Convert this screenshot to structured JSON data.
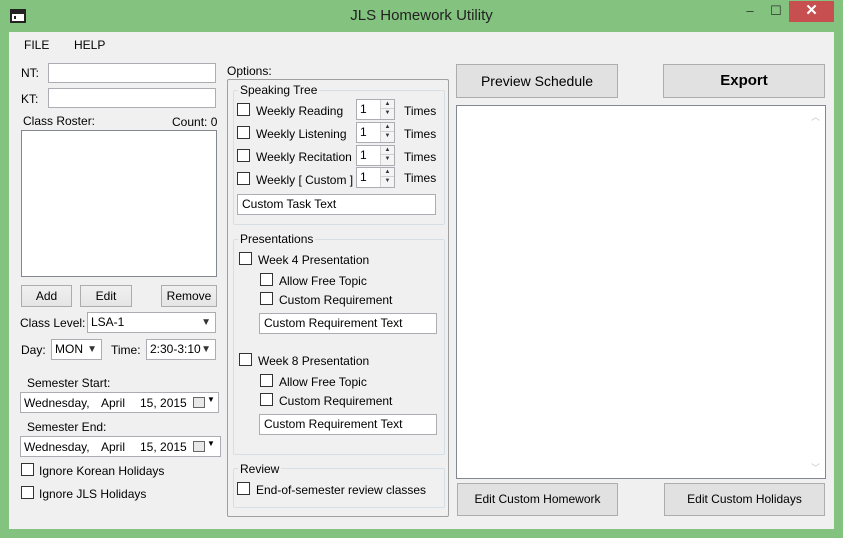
{
  "window": {
    "title": "JLS Homework Utility",
    "minimize_glyph": "–",
    "maximize_glyph": "☐",
    "close_glyph": "✕"
  },
  "menu": {
    "file": "FILE",
    "help": "HELP"
  },
  "left": {
    "nt_label": "NT:",
    "nt_value": "",
    "kt_label": "KT:",
    "kt_value": "",
    "roster_label": "Class Roster:",
    "count_label": "Count: 0",
    "add_button": "Add",
    "edit_button": "Edit",
    "remove_button": "Remove",
    "class_level_label": "Class Level:",
    "class_level_value": "LSA-1",
    "day_label": "Day:",
    "day_value": "MON",
    "time_label": "Time:",
    "time_value": "2:30-3:10",
    "semester_start_label": "Semester Start:",
    "semester_start": {
      "weekday": "Wednesday,",
      "month": "April",
      "day": "15, 2015"
    },
    "semester_end_label": "Semester End:",
    "semester_end": {
      "weekday": "Wednesday,",
      "month": "April",
      "day": "15, 2015"
    },
    "ignore_korean": "Ignore Korean Holidays",
    "ignore_jls": "Ignore JLS Holidays"
  },
  "options": {
    "label": "Options:",
    "speaking_tree": {
      "title": "Speaking Tree",
      "times_label": "Times",
      "items": [
        {
          "label": "Weekly Reading",
          "value": "1"
        },
        {
          "label": "Weekly Listening",
          "value": "1"
        },
        {
          "label": "Weekly Recitation",
          "value": "1"
        },
        {
          "label": "Weekly [ Custom ]",
          "value": "1"
        }
      ],
      "custom_task_text": "Custom Task Text"
    },
    "presentations": {
      "title": "Presentations",
      "week4": "Week 4 Presentation",
      "week4_free": "Allow Free Topic",
      "week4_custom": "Custom Requirement",
      "week4_custom_text": "Custom Requirement Text",
      "week8": "Week 8 Presentation",
      "week8_free": "Allow Free Topic",
      "week8_custom": "Custom Requirement",
      "week8_custom_text": "Custom Requirement Text"
    },
    "review": {
      "title": "Review",
      "end_of_semester": "End-of-semester review classes"
    }
  },
  "right": {
    "preview_button": "Preview Schedule",
    "export_button": "Export",
    "edit_homework_button": "Edit Custom Homework",
    "edit_holidays_button": "Edit Custom Holidays"
  }
}
